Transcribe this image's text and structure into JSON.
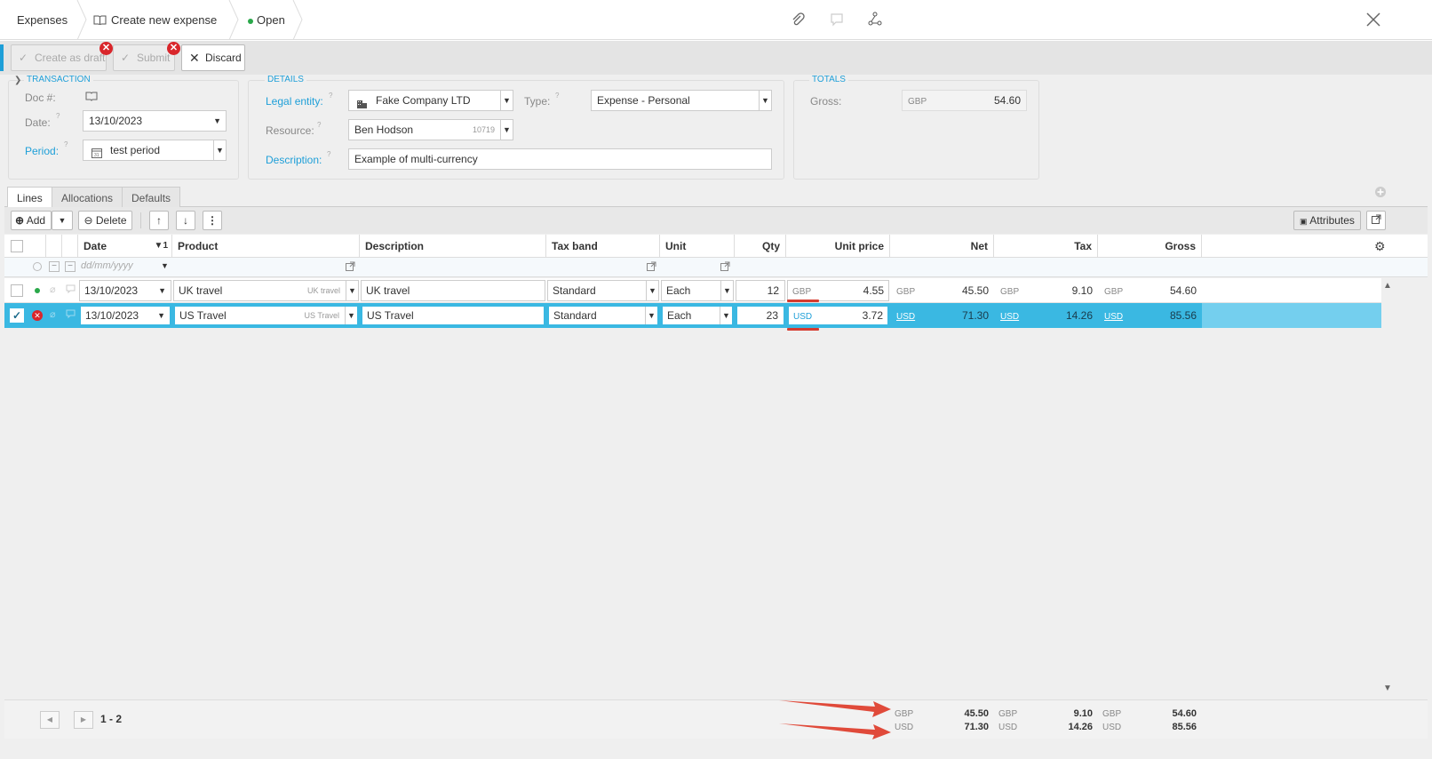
{
  "header": {
    "crumb1": "Expenses",
    "crumb2": "Create new expense",
    "crumb3": "Open",
    "status_color": "#2aa84a"
  },
  "toolbar": {
    "create_draft": "Create as draft",
    "submit": "Submit",
    "discard": "Discard"
  },
  "transaction": {
    "legend": "TRANSACTION",
    "doc_label": "Doc #:",
    "date_label": "Date:",
    "date_value": "13/10/2023",
    "period_label": "Period:",
    "period_value": "test period"
  },
  "details": {
    "legend": "DETAILS",
    "legal_label": "Legal entity:",
    "legal_value": "Fake Company LTD",
    "type_label": "Type:",
    "type_value": "Expense - Personal",
    "resource_label": "Resource:",
    "resource_value": "Ben Hodson",
    "resource_code": "10719",
    "desc_label": "Description:",
    "desc_value": "Example of multi-currency"
  },
  "totals": {
    "legend": "TOTALS",
    "gross_label": "Gross:",
    "gross_currency": "GBP",
    "gross_value": "54.60"
  },
  "tabs": [
    "Lines",
    "Allocations",
    "Defaults"
  ],
  "grid_toolbar": {
    "add": "Add",
    "delete": "Delete",
    "attributes": "Attributes"
  },
  "columns": {
    "date": "Date",
    "sort": "1",
    "product": "Product",
    "description": "Description",
    "tax_band": "Tax band",
    "unit": "Unit",
    "qty": "Qty",
    "unit_price": "Unit price",
    "net": "Net",
    "tax": "Tax",
    "gross": "Gross"
  },
  "filter": {
    "date_placeholder": "dd/mm/yyyy"
  },
  "rows": [
    {
      "date": "13/10/2023",
      "product": "UK travel",
      "product_code": "UK travel",
      "description": "UK travel",
      "tax_band": "Standard",
      "unit": "Each",
      "qty": "12",
      "price_currency": "GBP",
      "price": "4.55",
      "net_currency": "GBP",
      "net": "45.50",
      "tax_currency": "GBP",
      "tax": "9.10",
      "gross_currency": "GBP",
      "gross": "54.60"
    },
    {
      "date": "13/10/2023",
      "product": "US Travel",
      "product_code": "US Travel",
      "description": "US Travel",
      "tax_band": "Standard",
      "unit": "Each",
      "qty": "23",
      "price_currency": "USD",
      "price": "3.72",
      "net_currency": "USD",
      "net": "71.30",
      "tax_currency": "USD",
      "tax": "14.26",
      "gross_currency": "USD",
      "gross": "85.56"
    }
  ],
  "pager": {
    "range": "1 - 2"
  },
  "summary": [
    {
      "net_currency": "GBP",
      "net": "45.50",
      "tax_currency": "GBP",
      "tax": "9.10",
      "gross_currency": "GBP",
      "gross": "54.60"
    },
    {
      "net_currency": "USD",
      "net": "71.30",
      "tax_currency": "USD",
      "tax": "14.26",
      "gross_currency": "USD",
      "gross": "85.56"
    }
  ],
  "colors": {
    "accent": "#1e9fd8",
    "selected_row": "#3ab8e2",
    "error": "#d9262b",
    "arrow": "#e04a3a"
  }
}
